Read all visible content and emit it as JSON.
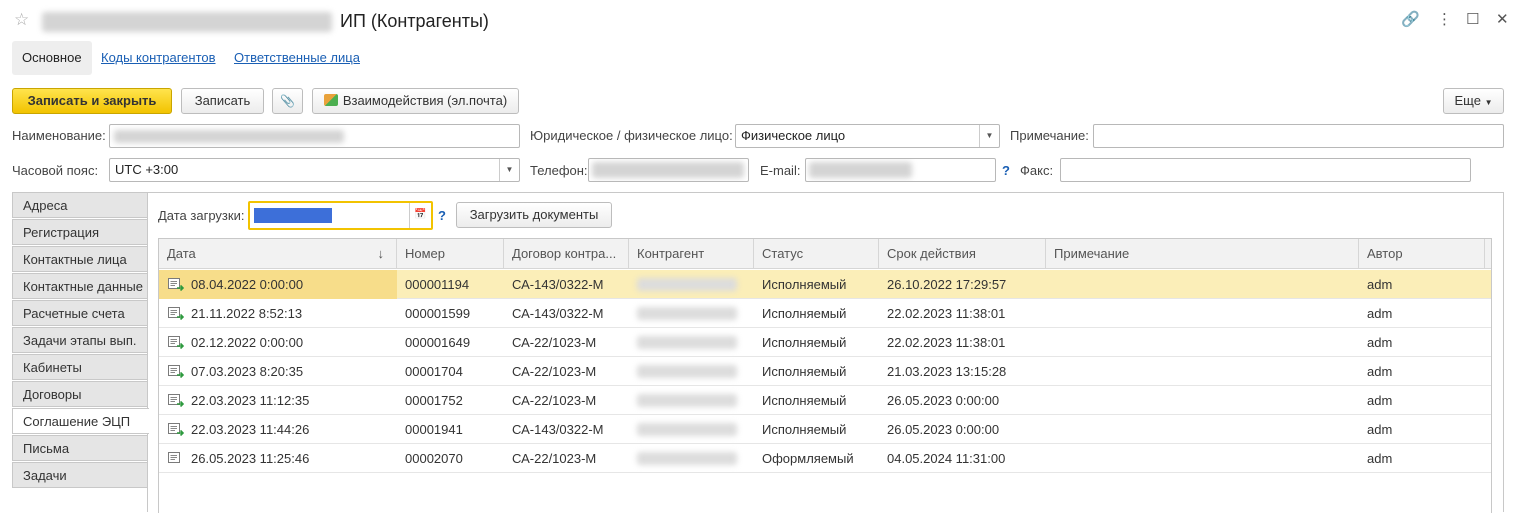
{
  "window": {
    "title": "ИП (Контрагенты)",
    "star_icon": "☆",
    "link_icon": "🔗",
    "more_icon": "⋮",
    "maximize_icon": "☐",
    "close_icon": "✕"
  },
  "form_tabs": [
    "Основное",
    "Коды контрагентов",
    "Ответственные лица"
  ],
  "toolbar": {
    "save_close": "Записать и закрыть",
    "save": "Записать",
    "attach_icon": "📎",
    "interactions": "Взаимодействия (эл.почта)",
    "more": "Еще"
  },
  "fields": {
    "name_label": "Наименование:",
    "legal_label": "Юридическое / физическое лицо:",
    "legal_value": "Физическое лицо",
    "note_label": "Примечание:",
    "note_value": "",
    "tz_label": "Часовой пояс:",
    "tz_value": "UTC +3:00",
    "phone_label": "Телефон:",
    "email_label": "E-mail:",
    "help": "?",
    "fax_label": "Факс:",
    "fax_value": ""
  },
  "side_tabs": [
    "Адреса",
    "Регистрация",
    "Контактные лица",
    "Контактные данные",
    "Расчетные счета",
    "Задачи этапы вып.",
    "Кабинеты",
    "Договоры",
    "Соглашение ЭЦП",
    "Письма",
    "Задачи"
  ],
  "active_side_tab": "Соглашение ЭЦП",
  "load": {
    "date_label": "Дата загрузки:",
    "calendar_icon": "📅",
    "help": "?",
    "load_button": "Загрузить документы"
  },
  "table": {
    "sort_icon": "↓",
    "columns": [
      "Дата",
      "Номер",
      "Договор контра...",
      "Контрагент",
      "Статус",
      "Срок действия",
      "Примечание",
      "Автор"
    ],
    "rows": [
      {
        "date": "08.04.2022 0:00:00",
        "number": "000001194",
        "contract": "СА-143/0322-М",
        "status": "Исполняемый",
        "valid": "26.10.2022 17:29:57",
        "note": "",
        "author": "adm",
        "icon": "doc-arrow-icon"
      },
      {
        "date": "21.11.2022 8:52:13",
        "number": "000001599",
        "contract": "СА-143/0322-М",
        "status": "Исполняемый",
        "valid": "22.02.2023 11:38:01",
        "note": "",
        "author": "adm",
        "icon": "doc-arrow-icon"
      },
      {
        "date": "02.12.2022 0:00:00",
        "number": "000001649",
        "contract": "СА-22/1023-М",
        "status": "Исполняемый",
        "valid": "22.02.2023 11:38:01",
        "note": "",
        "author": "adm",
        "icon": "doc-arrow-icon"
      },
      {
        "date": "07.03.2023 8:20:35",
        "number": "00001704",
        "contract": "СА-22/1023-М",
        "status": "Исполняемый",
        "valid": "21.03.2023 13:15:28",
        "note": "",
        "author": "adm",
        "icon": "doc-arrow-icon"
      },
      {
        "date": "22.03.2023 11:12:35",
        "number": "00001752",
        "contract": "СА-22/1023-М",
        "status": "Исполняемый",
        "valid": "26.05.2023 0:00:00",
        "note": "",
        "author": "adm",
        "icon": "doc-arrow-icon"
      },
      {
        "date": "22.03.2023 11:44:26",
        "number": "00001941",
        "contract": "СА-143/0322-М",
        "status": "Исполняемый",
        "valid": "26.05.2023 0:00:00",
        "note": "",
        "author": "adm",
        "icon": "doc-arrow-icon"
      },
      {
        "date": "26.05.2023 11:25:46",
        "number": "00002070",
        "contract": "СА-22/1023-М",
        "status": "Оформляемый",
        "valid": "04.05.2024 11:31:00",
        "note": "",
        "author": "adm",
        "icon": "doc-icon"
      }
    ]
  },
  "colors": {
    "accent_yellow": "#f2c300",
    "selected_row": "#fbeeb8",
    "link": "#1a5fb4"
  }
}
